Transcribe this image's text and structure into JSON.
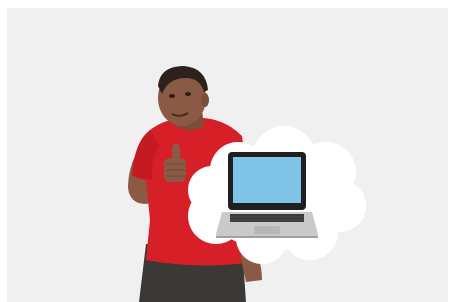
{
  "image": {
    "subject": "man-thumbs-up",
    "thought_bubble_icon": "laptop-icon"
  },
  "colors": {
    "background": "#f0f0f0",
    "shirt": "#d61f26",
    "skin": "#8a5a45",
    "hair": "#2c211d",
    "pants": "#3b3936",
    "bubble": "#ffffff",
    "laptop_screen": "#7fc3e8",
    "laptop_body": "#c9cacc",
    "laptop_bezel": "#1f1f1f"
  }
}
